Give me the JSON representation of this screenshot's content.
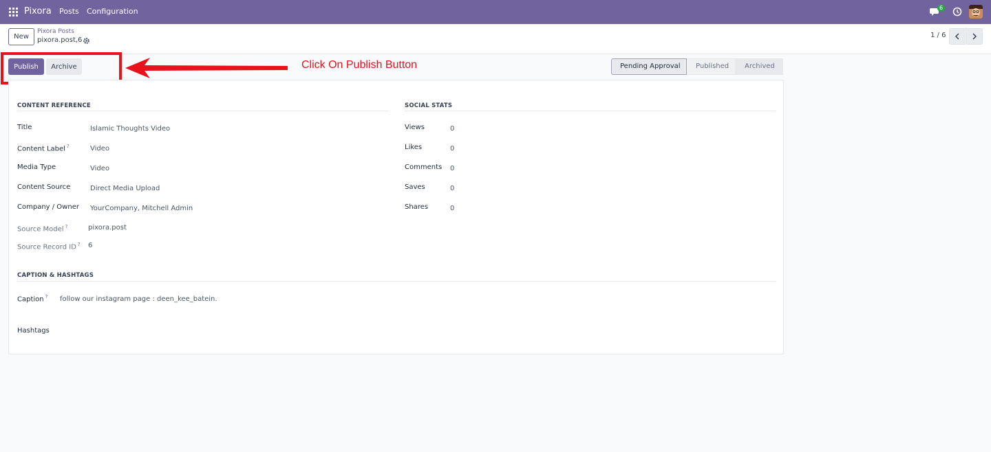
{
  "navbar": {
    "brand": "Pixora",
    "menu": [
      "Posts",
      "Configuration"
    ],
    "chat_count": "6",
    "icons": {
      "apps": "apps-grid-icon",
      "chat": "chat-icon",
      "activity": "clock-icon",
      "user": "avatar"
    }
  },
  "control_panel": {
    "new_label": "New",
    "breadcrumb_parent": "Pixora Posts",
    "breadcrumb_current": "pixora.post,6",
    "pager": "1 / 6"
  },
  "actions": {
    "publish_label": "Publish",
    "archive_label": "Archive"
  },
  "annotation": {
    "text": "Click On Publish Button",
    "color": "#e8111c"
  },
  "status": {
    "stages": [
      "Pending Approval",
      "Published",
      "Archived"
    ],
    "current": "Pending Approval"
  },
  "content_reference": {
    "title": "CONTENT REFERENCE",
    "fields": [
      {
        "label": "Title",
        "value": "Islamic Thoughts Video"
      },
      {
        "label": "Content Label",
        "value": "Video"
      },
      {
        "label": "Media Type",
        "value": "Video"
      },
      {
        "label": "Content Source",
        "value": "Direct Media Upload"
      },
      {
        "label": "Company / Owner",
        "value": "YourCompany, Mitchell Admin"
      },
      {
        "label": "Source Model",
        "value": "pixora.post"
      },
      {
        "label": "Source Record ID",
        "value": "6"
      }
    ]
  },
  "social_stats": {
    "title": "SOCIAL STATS",
    "fields": [
      {
        "label": "Views",
        "value": "0"
      },
      {
        "label": "Likes",
        "value": "0"
      },
      {
        "label": "Comments",
        "value": "0"
      },
      {
        "label": "Saves",
        "value": "0"
      },
      {
        "label": "Shares",
        "value": "0"
      }
    ]
  },
  "caption_hashtags": {
    "title": "CAPTION & HASHTAGS",
    "caption_label": "Caption",
    "caption_value": "follow our instagram page : deen_kee_batein.",
    "hashtags_label": "Hashtags"
  },
  "help_mark": "?",
  "colors": {
    "brand": "#71639e",
    "accent_red": "#e8111c"
  }
}
